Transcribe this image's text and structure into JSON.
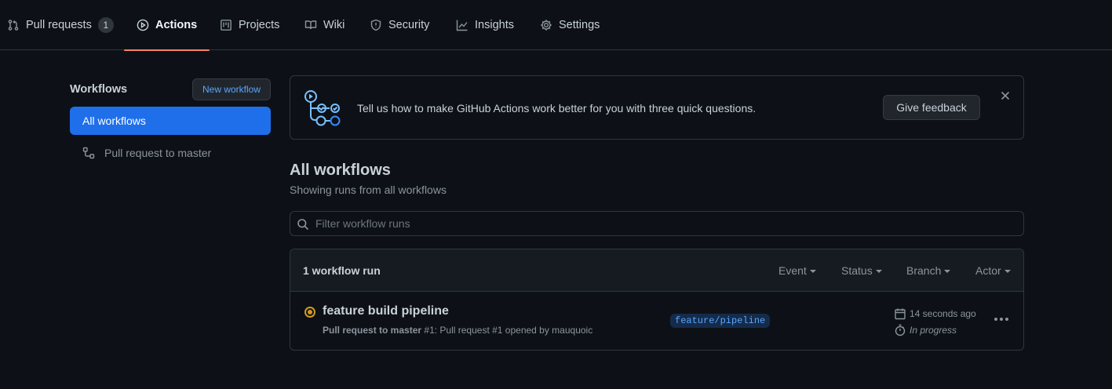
{
  "tabs": [
    {
      "label": "Pull requests",
      "count": "1",
      "icon": "git-pull-request-icon"
    },
    {
      "label": "Actions",
      "icon": "play-icon",
      "active": true
    },
    {
      "label": "Projects",
      "icon": "project-icon"
    },
    {
      "label": "Wiki",
      "icon": "book-icon"
    },
    {
      "label": "Security",
      "icon": "shield-icon"
    },
    {
      "label": "Insights",
      "icon": "graph-icon"
    },
    {
      "label": "Settings",
      "icon": "gear-icon"
    }
  ],
  "sidebar": {
    "title": "Workflows",
    "new_workflow_label": "New workflow",
    "items": [
      {
        "label": "All workflows",
        "active": true
      },
      {
        "label": "Pull request to master",
        "icon": "workflow-icon"
      }
    ]
  },
  "banner": {
    "text": "Tell us how to make GitHub Actions work better for you with three quick questions.",
    "button_label": "Give feedback"
  },
  "main": {
    "title": "All workflows",
    "subtitle": "Showing runs from all workflows",
    "filter_placeholder": "Filter workflow runs"
  },
  "runs": {
    "count_label": "1 workflow run",
    "filters": [
      "Event",
      "Status",
      "Branch",
      "Actor"
    ],
    "items": [
      {
        "title": "feature build pipeline",
        "workflow": "Pull request to master",
        "meta": "#1: Pull request #1 opened by mauquoic",
        "branch": "feature/pipeline",
        "time": "14 seconds ago",
        "status": "In progress"
      }
    ]
  },
  "colors": {
    "background": "#0d1117",
    "accent_blue": "#1f6feb",
    "tab_underline": "#f78166",
    "in_progress": "#d29922"
  }
}
